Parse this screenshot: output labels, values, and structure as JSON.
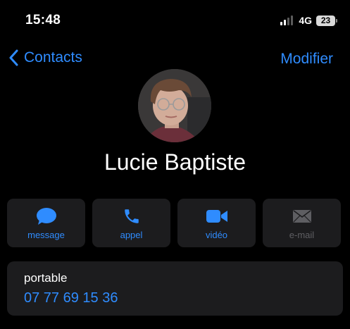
{
  "status_bar": {
    "time": "15:48",
    "network": "4G",
    "battery": "23"
  },
  "nav": {
    "back_label": "Contacts",
    "edit_label": "Modifier"
  },
  "contact": {
    "name": "Lucie Baptiste"
  },
  "actions": [
    {
      "label": "message",
      "icon": "message-bubble-icon",
      "enabled": true
    },
    {
      "label": "appel",
      "icon": "phone-icon",
      "enabled": true
    },
    {
      "label": "vidéo",
      "icon": "video-camera-icon",
      "enabled": true
    },
    {
      "label": "e-mail",
      "icon": "envelope-icon",
      "enabled": false
    }
  ],
  "phone": {
    "label": "portable",
    "number": "07 77 69 15 36"
  },
  "colors": {
    "background": "#000000",
    "card": "#1c1c1e",
    "accent": "#2f8cff",
    "disabled": "#5e5e62",
    "text": "#ffffff"
  }
}
